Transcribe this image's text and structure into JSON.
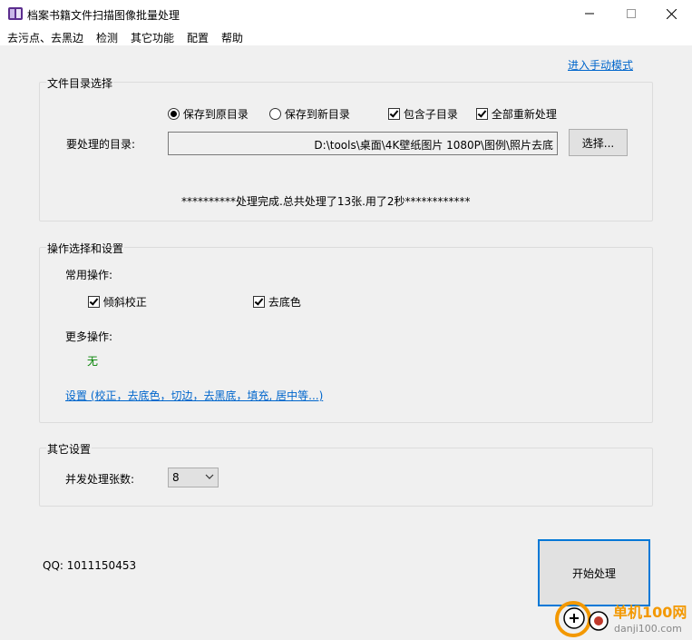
{
  "window": {
    "title": "档案书籍文件扫描图像批量处理"
  },
  "menu": [
    "去污点、去黑边",
    "检测",
    "其它功能",
    "配置",
    "帮助"
  ],
  "manual_mode_link": "进入手动模式",
  "dir_group": {
    "title": "文件目录选择",
    "save_to_original": "保存到原目录",
    "save_to_new": "保存到新目录",
    "include_subdirs": "包含子目录",
    "reprocess_all": "全部重新处理",
    "dir_label": "要处理的目录:",
    "dir_value": "D:\\tools\\桌面\\4K壁纸图片 1080P\\图例\\照片去底",
    "browse_button": "选择...",
    "status": "**********处理完成.总共处理了13张.用了2秒************"
  },
  "ops_group": {
    "title": "操作选择和设置",
    "common_label": "常用操作:",
    "deskew": "倾斜校正",
    "remove_bg": "去底色",
    "more_label": "更多操作:",
    "more_value": "无",
    "settings_link": "设置 (校正，去底色，切边，去黑底，填充, 居中等...)"
  },
  "other_group": {
    "title": "其它设置",
    "concurrency_label": "并发处理张数:",
    "concurrency_value": "8"
  },
  "qq": "QQ: 1011150453",
  "start_button": "开始处理",
  "watermark": {
    "text": "单机100网",
    "url": "danji100.com"
  },
  "colors": {
    "accent": "#0078d7",
    "link": "#0066cc",
    "none_green": "#008000",
    "watermark_orange": "#f39800"
  },
  "state": {
    "save_to_original": true,
    "save_to_new": false,
    "include_subdirs": true,
    "reprocess_all": true,
    "deskew": true,
    "remove_bg": true
  }
}
